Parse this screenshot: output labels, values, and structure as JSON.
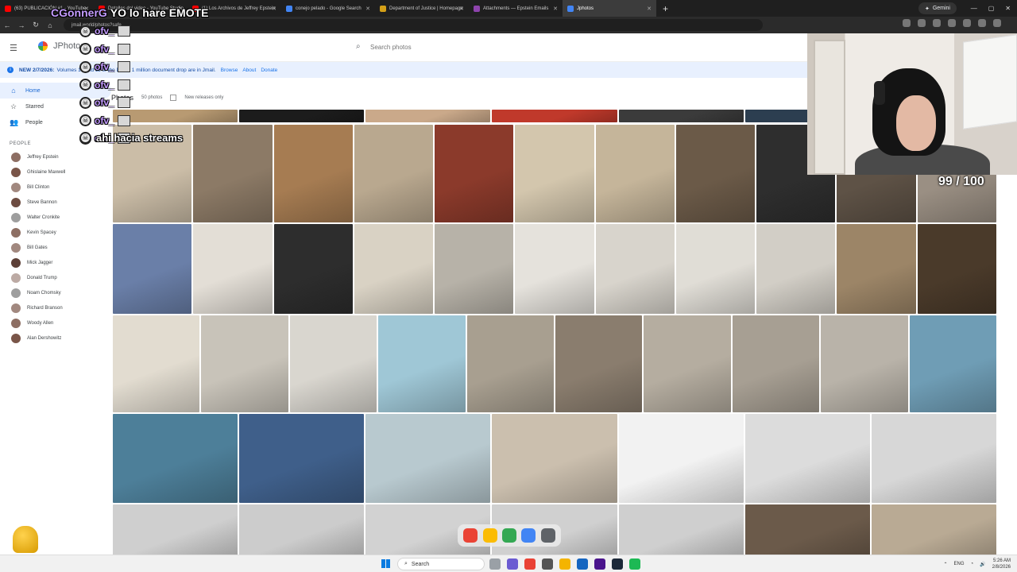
{
  "browser": {
    "tabs": [
      {
        "title": "(63) PUBLICACIÓN #1 - YouTube",
        "favicon_color": "#ff0000"
      },
      {
        "title": "Detalles del video - YouTube Studio",
        "favicon_color": "#ff0000"
      },
      {
        "title": "(1) Los Archivos de Jeffrey Epstein",
        "favicon_color": "#ff0000"
      },
      {
        "title": "conejo pelado - Google Search",
        "favicon_color": "#4285f4"
      },
      {
        "title": "Department of Justice | Homepage",
        "favicon_color": "#d4a017"
      },
      {
        "title": "Attachments — Epstein Emails",
        "favicon_color": "#8e44ad"
      },
      {
        "title": "Jphotos",
        "favicon_color": "#4285f4"
      }
    ],
    "new_tab": "+",
    "gemini_label": "Gemini",
    "url": "jmail.world/photos?safe",
    "window_controls": [
      "—",
      "▢",
      "✕"
    ]
  },
  "app": {
    "brand": "JPhotos",
    "search_placeholder": "Search photos",
    "banner": {
      "date": "NEW 2/7/2026:",
      "text": "Volumes 10 and 11 of the DOJ's 1 million document drop are in Jmail.",
      "links": [
        "Browse",
        "About",
        "Donate"
      ]
    },
    "toolbar": {
      "title": "Photos",
      "count": "50 photos",
      "checkbox_label": "New releases only"
    }
  },
  "sidebar": {
    "nav": [
      {
        "label": "Home",
        "icon": "home-icon",
        "active": true
      },
      {
        "label": "Starred",
        "icon": "star-icon",
        "active": false
      },
      {
        "label": "People",
        "icon": "people-icon",
        "active": false
      }
    ],
    "people_heading": "PEOPLE",
    "people": [
      {
        "name": "Jeffrey Epstein",
        "color": "#8d6e63"
      },
      {
        "name": "Ghislaine Maxwell",
        "color": "#795548"
      },
      {
        "name": "Bill Clinton",
        "color": "#a1887f"
      },
      {
        "name": "Steve Bannon",
        "color": "#6d4c41"
      },
      {
        "name": "Walter Cronkite",
        "color": "#9e9e9e"
      },
      {
        "name": "Kevin Spacey",
        "color": "#8d6e63"
      },
      {
        "name": "Bill Gates",
        "color": "#a1887f"
      },
      {
        "name": "Mick Jagger",
        "color": "#5d4037"
      },
      {
        "name": "Donald Trump",
        "color": "#bcaaa4"
      },
      {
        "name": "Noam Chomsky",
        "color": "#9e9e9e"
      },
      {
        "name": "Richard Branson",
        "color": "#a1887f"
      },
      {
        "name": "Woody Allen",
        "color": "#8d6e63"
      },
      {
        "name": "Alan Dershowitz",
        "color": "#795548"
      }
    ]
  },
  "grid": {
    "rows": [
      {
        "photos": [
          {
            "color": "#b89a72",
            "subject": "staircase"
          },
          {
            "color": "#1c1c1c",
            "subject": "dark room"
          },
          {
            "color": "#caa98a",
            "subject": "hallway"
          },
          {
            "color": "#c0392b",
            "subject": "red wall"
          },
          {
            "color": "#3b3b3b",
            "subject": "doorway"
          },
          {
            "color": "#2c3e50",
            "subject": "blue room"
          },
          {
            "color": "#d6c7b3",
            "subject": "living room"
          }
        ]
      },
      {
        "photos": [
          {
            "color": "#cbbda7",
            "subject": "kitchen"
          },
          {
            "color": "#8c7a66",
            "subject": "kitchen counter"
          },
          {
            "color": "#a67c52",
            "subject": "dining room"
          },
          {
            "color": "#b9a88f",
            "subject": "dining room"
          },
          {
            "color": "#8b3a2b",
            "subject": "red doorway"
          },
          {
            "color": "#d3c6ad",
            "subject": "hallway"
          },
          {
            "color": "#c5b59a",
            "subject": "corridor"
          },
          {
            "color": "#6b5a48",
            "subject": "office"
          },
          {
            "color": "#2e2e2e",
            "subject": "bedroom"
          },
          {
            "color": "#5e5246",
            "subject": "study"
          },
          {
            "color": "#9a8f83",
            "subject": "room"
          }
        ]
      },
      {
        "photos": [
          {
            "color": "#6a7fa8",
            "subject": "portrait"
          },
          {
            "color": "#e3ded6",
            "subject": "office desk"
          },
          {
            "color": "#2d2d2d",
            "subject": "monitors"
          },
          {
            "color": "#d9d2c4",
            "subject": "checkered kitchen"
          },
          {
            "color": "#b7b2a8",
            "subject": "kitchen"
          },
          {
            "color": "#e5e2dc",
            "subject": "white room"
          },
          {
            "color": "#d8d4cc",
            "subject": "empty room"
          },
          {
            "color": "#e0ddd6",
            "subject": "hallway"
          },
          {
            "color": "#d2cec6",
            "subject": "room"
          },
          {
            "color": "#9c8567",
            "subject": "doorway"
          },
          {
            "color": "#4a3a2a",
            "subject": "storage"
          }
        ]
      },
      {
        "photos": [
          {
            "color": "#e2dcd0",
            "subject": "corridor"
          },
          {
            "color": "#c8c3b9",
            "subject": "laundry"
          },
          {
            "color": "#d9d6cf",
            "subject": "washers"
          },
          {
            "color": "#9fc7d6",
            "subject": "pipes"
          },
          {
            "color": "#a89f90",
            "subject": "storage"
          },
          {
            "color": "#8a7d6e",
            "subject": "clutter"
          },
          {
            "color": "#b5ada0",
            "subject": "basement"
          },
          {
            "color": "#a79f93",
            "subject": "shelves"
          },
          {
            "color": "#b9b3a9",
            "subject": "stairs"
          },
          {
            "color": "#6f9db5",
            "subject": "machinery"
          }
        ]
      },
      {
        "photos": [
          {
            "color": "#4d7f99",
            "subject": "pumps"
          },
          {
            "color": "#3f5f8a",
            "subject": "boiler room"
          },
          {
            "color": "#b8c9cf",
            "subject": "pipes"
          },
          {
            "color": "#cbbfae",
            "subject": "boxes"
          },
          {
            "color": "#f2f2f2",
            "subject": "monitor"
          },
          {
            "color": "#dcdcdc",
            "subject": "floor plan"
          },
          {
            "color": "#d7d7d7",
            "subject": "floor plan"
          }
        ]
      },
      {
        "photos": [
          {
            "color": "#cfcfcf",
            "subject": "floor plan"
          },
          {
            "color": "#cccccc",
            "subject": "floor plan"
          },
          {
            "color": "#d2d2d2",
            "subject": "floor plan"
          },
          {
            "color": "#d0d0d0",
            "subject": "floor plan"
          },
          {
            "color": "#cfcfcf",
            "subject": "floor plan"
          },
          {
            "color": "#6b5a4a",
            "subject": "staircase"
          },
          {
            "color": "#b9aa94",
            "subject": "room"
          }
        ]
      }
    ]
  },
  "stream_overlay": {
    "top_chat": {
      "user": "CGonnerG",
      "message": "YO lo hare EMOTE"
    },
    "chat_user": "ofv_",
    "chat_message": "ahi hacia streams",
    "counter": "99 / 100"
  },
  "taskbar": {
    "search_label": "Search",
    "lang": "ENG",
    "time": "5:26 AM",
    "date": "2/8/2026"
  }
}
